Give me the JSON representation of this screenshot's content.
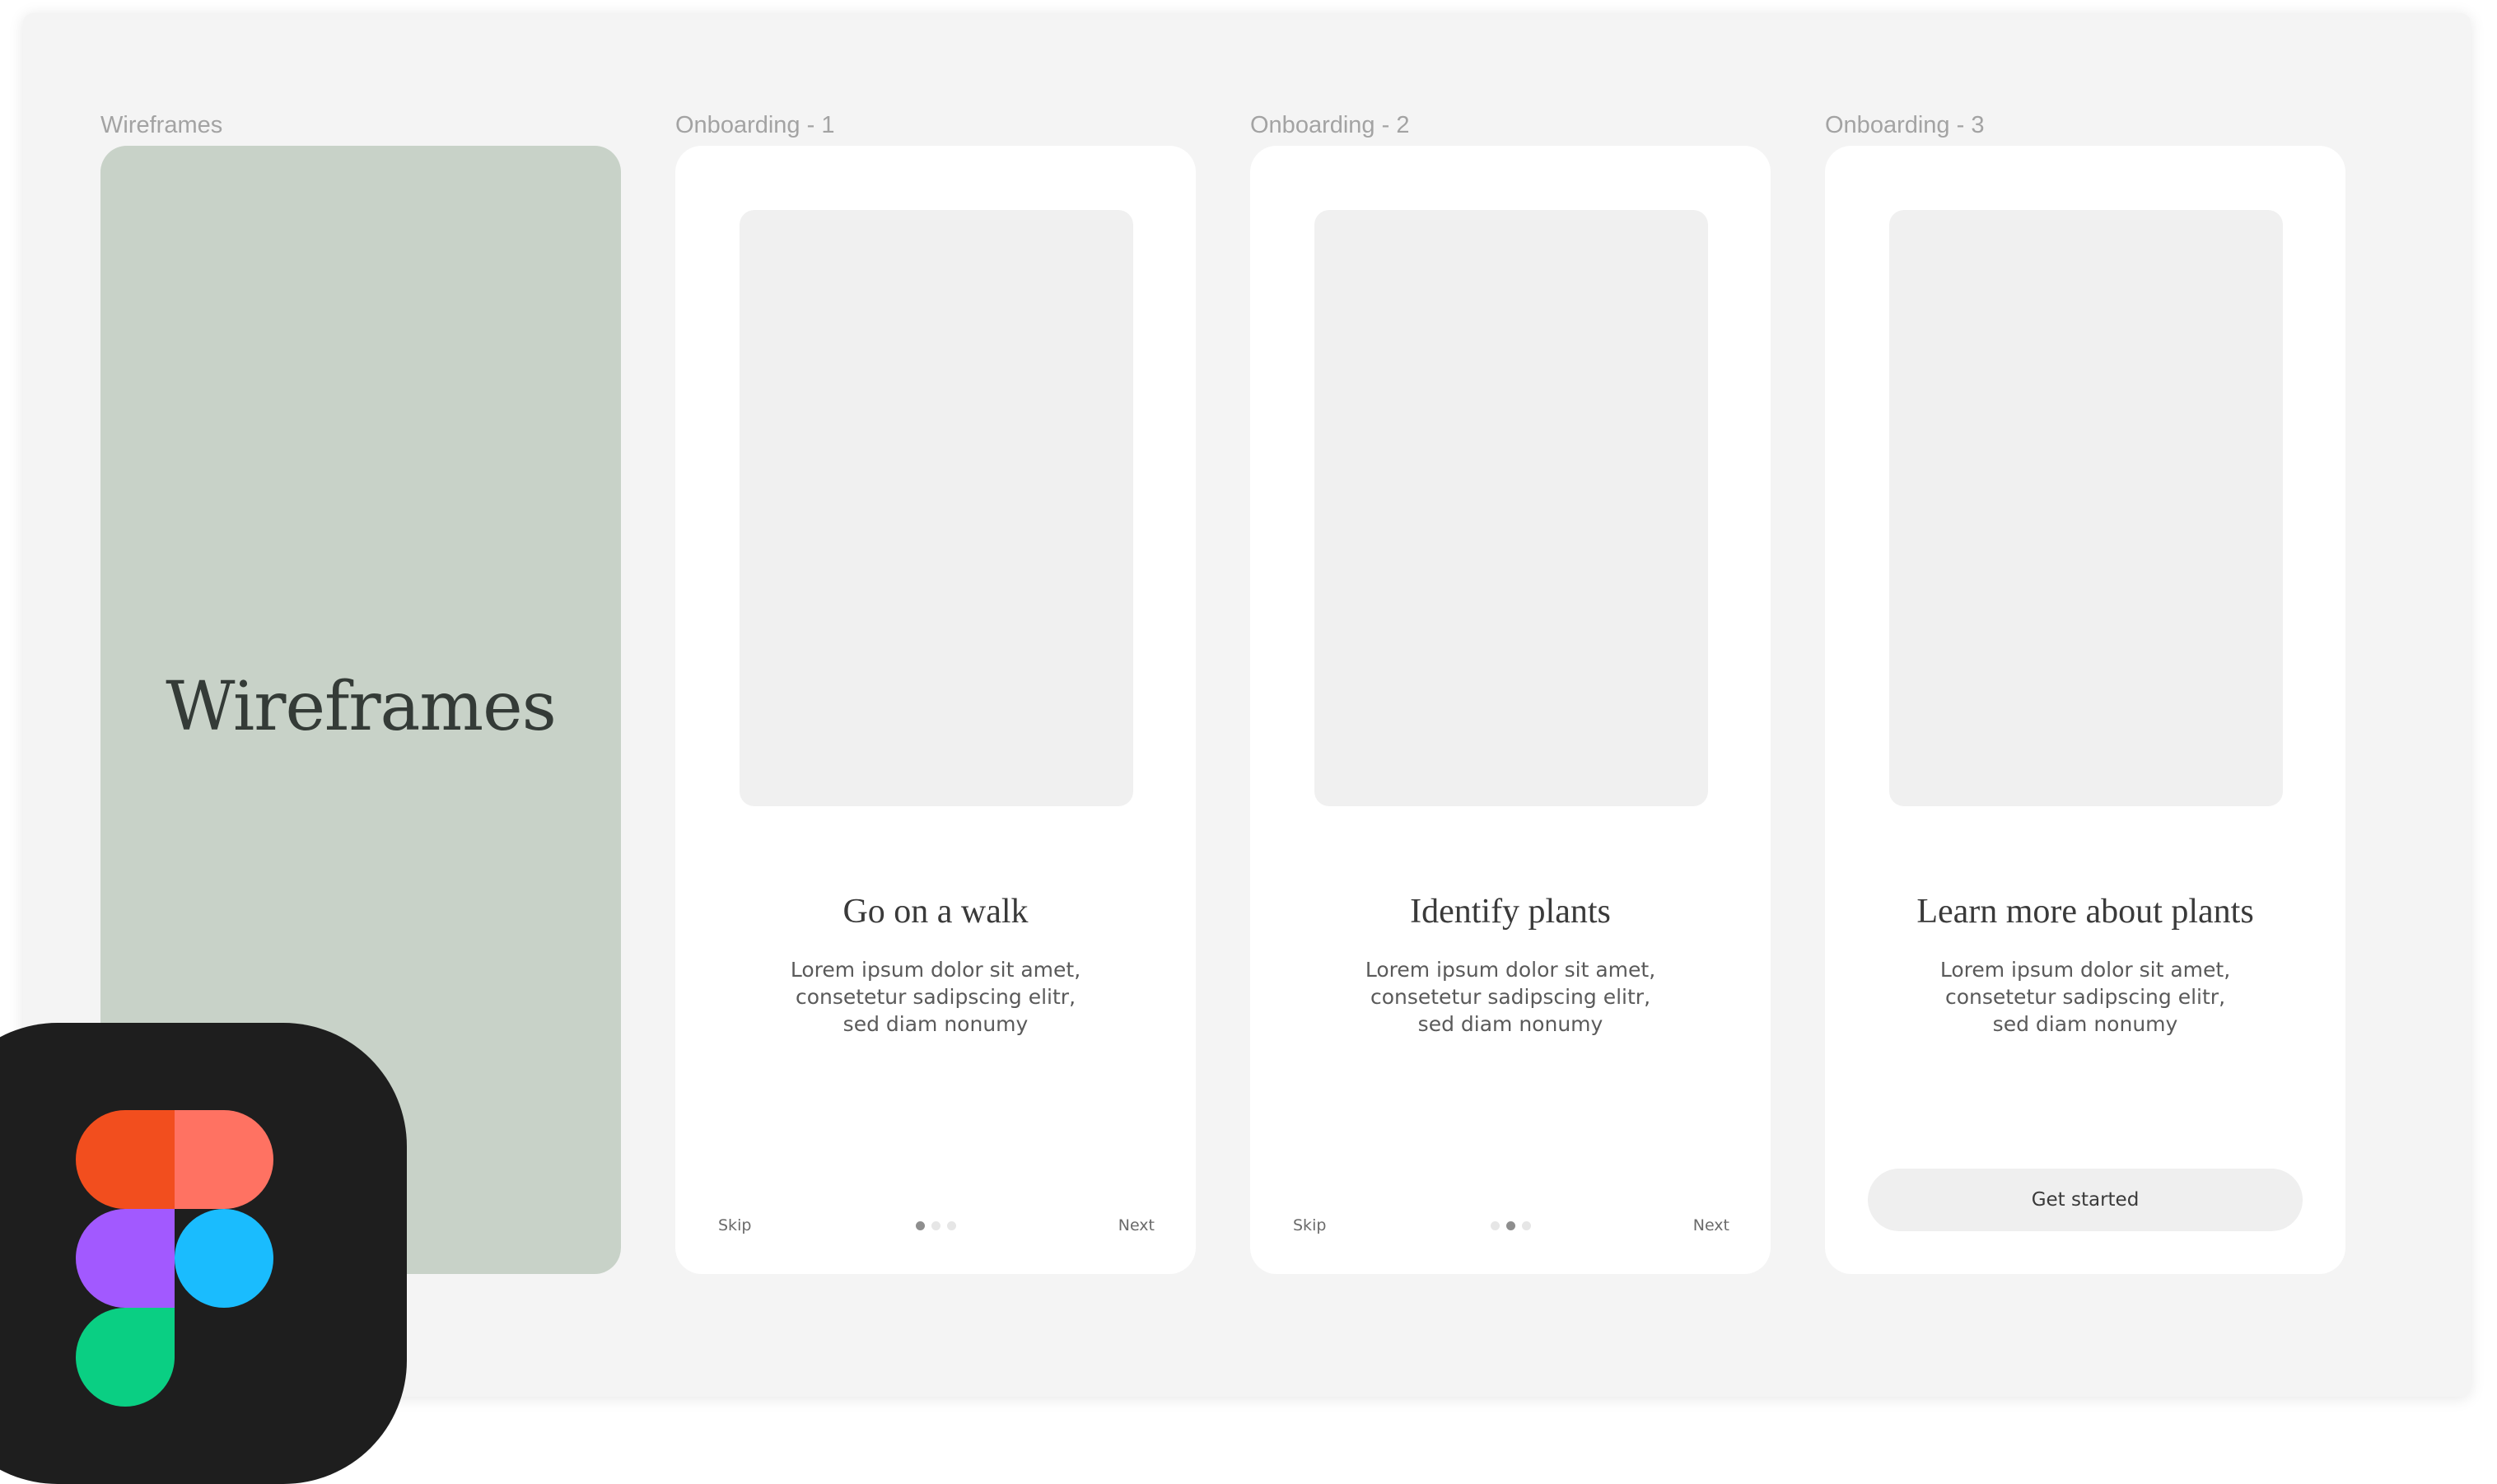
{
  "frames": [
    {
      "label": "Wireframes",
      "cover_text": "Wireframes",
      "bg_color": "#c8d2c8"
    },
    {
      "label": "Onboarding - 1",
      "title": "Go on a walk",
      "body": [
        "Lorem ipsum dolor sit amet,",
        "consetetur sadipscing elitr,",
        "sed diam nonumy"
      ],
      "skip": "Skip",
      "next": "Next",
      "active_dot": 1
    },
    {
      "label": "Onboarding - 2",
      "title": "Identify plants",
      "body": [
        "Lorem ipsum dolor sit amet,",
        "consetetur sadipscing elitr,",
        "sed diam nonumy"
      ],
      "skip": "Skip",
      "next": "Next",
      "active_dot": 2
    },
    {
      "label": "Onboarding - 3",
      "title": "Learn more about plants",
      "body": [
        "Lorem ipsum dolor sit amet,",
        "consetetur sadipscing elitr,",
        "sed diam nonumy"
      ],
      "cta": "Get started"
    }
  ],
  "colors": {
    "canvas": "#f4f4f4",
    "cover": "#c8d2c8",
    "placeholder": "#f0f0f0",
    "figma_red": "#f24e1e",
    "figma_coral": "#ff7262",
    "figma_purple": "#a259ff",
    "figma_blue": "#1abcfe",
    "figma_green": "#0acf83"
  },
  "icons": {
    "app_icon": "figma-logo-icon"
  }
}
